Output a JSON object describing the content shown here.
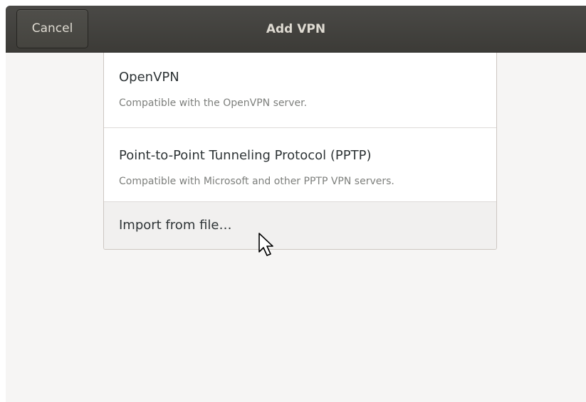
{
  "header": {
    "title": "Add VPN",
    "cancel_label": "Cancel"
  },
  "vpn_options": [
    {
      "title": "OpenVPN",
      "subtitle": "Compatible with the OpenVPN server."
    },
    {
      "title": "Point-to-Point Tunneling Protocol (PPTP)",
      "subtitle": "Compatible with Microsoft and other PPTP VPN servers."
    },
    {
      "title": "Import from file…"
    }
  ],
  "icons": {
    "pointer": "mouse-pointer-icon"
  },
  "colors": {
    "headerbar": "#3c3b37",
    "header_text": "#dfdbd2",
    "window_bg": "#f6f5f4",
    "row_title": "#2e3436",
    "row_subtitle": "#7d7f7c",
    "hover_row": "#f1f0ef"
  }
}
